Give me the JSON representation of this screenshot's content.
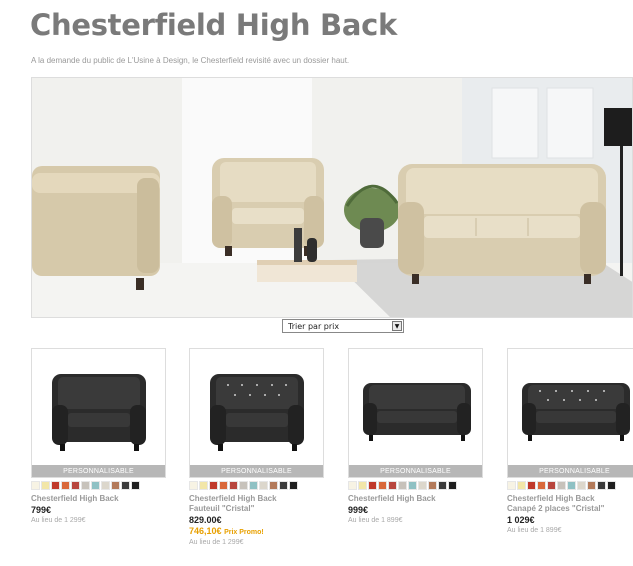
{
  "page": {
    "title": "Chesterfield High Back",
    "subtitle": "A la demande du public de L'Usine à Design, le Chesterfield revisité avec un dossier haut."
  },
  "sort": {
    "selected": "Trier par prix"
  },
  "colors": {
    "title": "#7a7a7a",
    "badge_bg": "#b7b7b7",
    "promo": "#e8a000",
    "sofa_leather": "#d9cdb0",
    "product_leather": "#2b2b2b"
  },
  "products": [
    {
      "badge": "PERSONNALISABLE",
      "name": "Chesterfield High Back",
      "subname": "",
      "price": "799€",
      "promo": "",
      "promo_label": "",
      "old_price": "Au lieu de 1 299€",
      "icon": "armchair-icon"
    },
    {
      "badge": "PERSONNALISABLE",
      "name": "Chesterfield High Back",
      "subname": "Fauteuil \"Cristal\"",
      "price": "829.00€",
      "promo": "746,10€",
      "promo_label": "Prix Promo!",
      "old_price": "Au lieu de 1 299€",
      "icon": "armchair-crystal-icon"
    },
    {
      "badge": "PERSONNALISABLE",
      "name": "Chesterfield High Back",
      "subname": "",
      "price": "999€",
      "promo": "",
      "promo_label": "",
      "old_price": "Au lieu de 1 899€",
      "icon": "sofa-icon"
    },
    {
      "badge": "PERSONNALISABLE",
      "name": "Chesterfield High Back",
      "subname": "Canapé 2 places \"Cristal\"",
      "price": "1 029€",
      "promo": "",
      "promo_label": "",
      "old_price": "Au lieu de 1 899€",
      "icon": "sofa-crystal-icon"
    }
  ],
  "swatches": [
    "#f7f3e4",
    "#f2e6a8",
    "#c0392b",
    "#d9683a",
    "#b8463e",
    "#c7c2bb",
    "#8fc1c4",
    "#dcd7cc",
    "#b37a5a",
    "#3a3a3a",
    "#1e1e1e"
  ]
}
